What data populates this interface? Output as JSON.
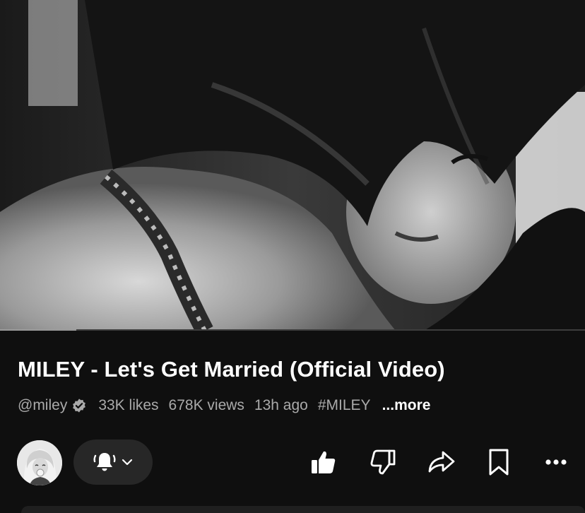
{
  "video": {
    "title": "MILEY - Let's Get Married (Official Video)",
    "progress_percent": 13
  },
  "meta": {
    "channel_handle": "@miley",
    "likes": "33K likes",
    "views": "678K views",
    "time_ago": "13h ago",
    "hashtag": "#MILEY",
    "more_label": "...more"
  },
  "icons": {
    "verified": "verified-badge-icon",
    "bell": "bell-ringing-icon",
    "chevron": "chevron-down-icon",
    "like": "thumbs-up-filled-icon",
    "dislike": "thumbs-down-icon",
    "share": "share-arrow-icon",
    "save": "bookmark-icon",
    "more": "more-horizontal-icon"
  },
  "colors": {
    "background": "#0f0f0f",
    "secondary_text": "#aaaaaa",
    "pill": "#272727"
  }
}
